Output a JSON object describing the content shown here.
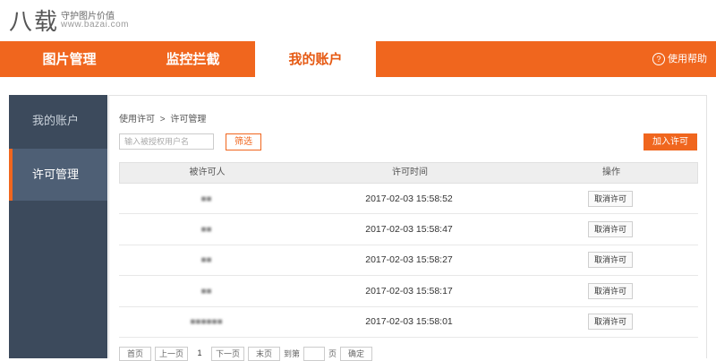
{
  "brand": {
    "logo": "八载",
    "slogan": "守护图片价值",
    "domain": "www.bazai.com"
  },
  "nav": {
    "items": [
      {
        "label": "图片管理",
        "active": false
      },
      {
        "label": "监控拦截",
        "active": false
      },
      {
        "label": "我的账户",
        "active": true
      }
    ],
    "help_label": "使用帮助",
    "help_icon": "question-circle-icon"
  },
  "sidebar": {
    "items": [
      {
        "label": "我的账户",
        "active": false
      },
      {
        "label": "许可管理",
        "active": true
      }
    ]
  },
  "main": {
    "breadcrumb": [
      "使用许可",
      ">",
      "许可管理"
    ],
    "search_placeholder": "输入被授权用户名",
    "filter_label": "筛选",
    "add_label": "加入许可",
    "columns": [
      "被许可人",
      "许可时间",
      "操作"
    ],
    "rows": [
      {
        "licensee": "■■",
        "time": "2017-02-03 15:58:52",
        "action": "取消许可"
      },
      {
        "licensee": "■■",
        "time": "2017-02-03 15:58:47",
        "action": "取消许可"
      },
      {
        "licensee": "■■",
        "time": "2017-02-03 15:58:27",
        "action": "取消许可"
      },
      {
        "licensee": "■■",
        "time": "2017-02-03 15:58:17",
        "action": "取消许可"
      },
      {
        "licensee": "■■■■■■",
        "time": "2017-02-03 15:58:01",
        "action": "取消许可"
      }
    ],
    "pagination": {
      "first": "首页",
      "prev": "上一页",
      "current": "1",
      "next": "下一页",
      "last": "末页",
      "goto_prefix": "到第",
      "goto_suffix": "页",
      "confirm": "确定"
    }
  },
  "colors": {
    "accent": "#f0661e",
    "sidebar_bg": "#3c4a5c",
    "sidebar_active": "#4e5f75"
  }
}
